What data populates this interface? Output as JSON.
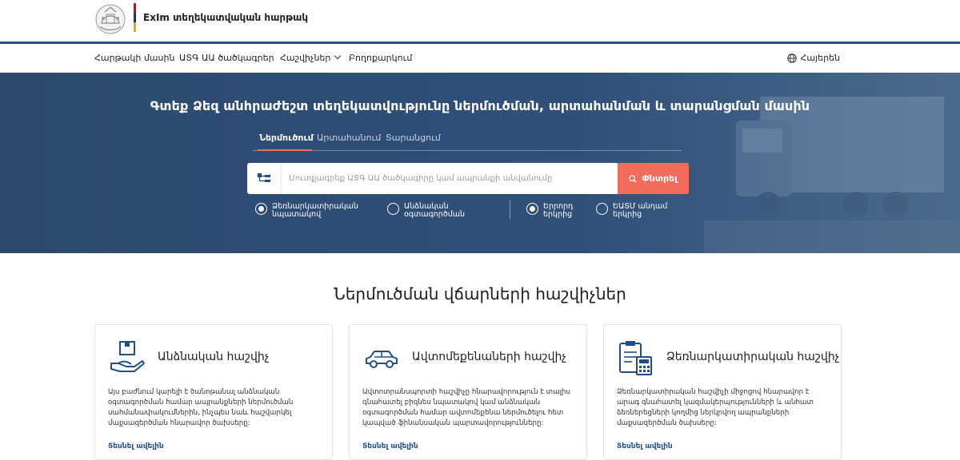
{
  "header": {
    "site_title": "ExIm տեղեկատվական հարթակ",
    "flag_colors": [
      "#d90012",
      "#0033a0",
      "#f2a800"
    ]
  },
  "nav": {
    "items": [
      {
        "label": "Հարթակի մասին"
      },
      {
        "label": "ԱՏԳ ԱԱ ծածկագրեր"
      },
      {
        "label": "Հաշվիչներ"
      },
      {
        "label": "Բողոքարկում"
      }
    ],
    "language": "Հայերեն"
  },
  "hero": {
    "title": "Գտեք Ձեզ անհրաժեշտ տեղեկատվությունը ներմուծման, արտահանման և տարանցման մասին",
    "tabs": [
      {
        "label": "Ներմուծում",
        "active": true
      },
      {
        "label": "Արտահանում",
        "active": false
      },
      {
        "label": "Տարանցում",
        "active": false
      }
    ],
    "search": {
      "placeholder": "Մուտքագրեք ԱՏԳ ԱԱ ծածկագիրը կամ ապրանքի անվանումը",
      "value": "",
      "button_label": "Փնտրել"
    },
    "radios": [
      {
        "label": "Ձեռնարկատիրական նպատակով",
        "checked": true
      },
      {
        "label": "Անձնական օգտագործման",
        "checked": false
      },
      {
        "label": "Երրորդ երկրից",
        "checked": true
      },
      {
        "label": "ԵԱՏՄ անդամ երկրից",
        "checked": false
      }
    ]
  },
  "calculators": {
    "section_title": "Ներմուծման վճարների հաշվիչներ",
    "cards": [
      {
        "icon": "hand-package-icon",
        "title": "Անձնական հաշվիչ",
        "description": "Այս բաժնում կարելի է ծանոթանալ անձնական օգտագործման համար ապրանքների ներմուծման սահմանափակումներին, ինչպես նաև հաշվարկել մաքսազերծման հնարավոր ծախսերը:",
        "more": "Տեսնել ավելին"
      },
      {
        "icon": "car-icon",
        "title": "Ավտոմեքենաների հաշվիչ",
        "description": "Ավտոտրանսպորտի հաշվիչը հնարավորություն է տալիս գնահատել բիզնես նպատակով կամ անձնական օգտագործման համար ավտոմեքենա ներմուծելու հետ կապված ֆինանսական պարտավորությունները:",
        "more": "Տեսնել ավելին"
      },
      {
        "icon": "clipboard-calculator-icon",
        "title": "Ձեռնարկատիրական հաշվիչ",
        "description": "Ձեռնարկատիրական հաշվիչի միջոցով հնարավոր է արագ գնահատել կազմակերպությունների և անհատ ձեռներեցների կողմից ներկրվող ապրանքների մաքսազերծման ծախսերը:",
        "more": "Տեսնել ավելին"
      }
    ]
  },
  "colors": {
    "accent": "#f26b5b",
    "hero_bg": "#2f4f78",
    "link": "#1f4e8c",
    "icon_blue": "#1f4e8c"
  }
}
